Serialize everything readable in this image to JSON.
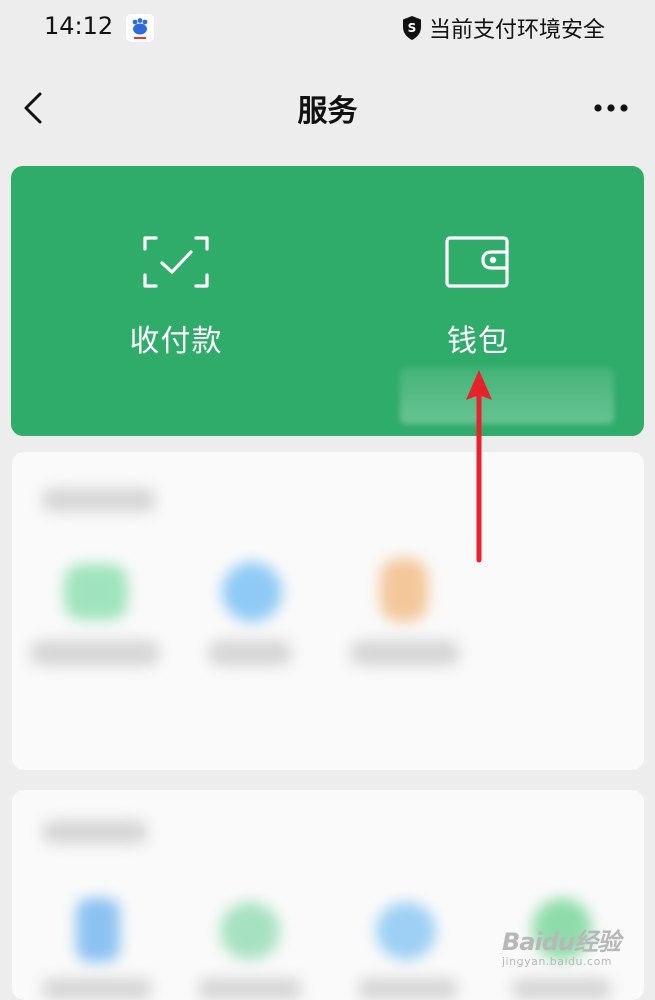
{
  "status_bar": {
    "time": "14:12",
    "security_text": "当前支付环境安全",
    "icons": [
      "baidu-app-icon",
      "shield-icon"
    ]
  },
  "header": {
    "title": "服务",
    "back_icon": "chevron-left-icon",
    "more_icon": "more-dots-icon"
  },
  "quick_actions": [
    {
      "label": "收付款",
      "icon": "scan-check-icon"
    },
    {
      "label": "钱包",
      "icon": "wallet-icon"
    }
  ],
  "colors": {
    "brand_green": "#2fac69",
    "background": "#ededed",
    "annotation_arrow": "#e8212b"
  },
  "watermark": {
    "main": "Baidu经验",
    "sub": "jingyan.baidu.com"
  }
}
